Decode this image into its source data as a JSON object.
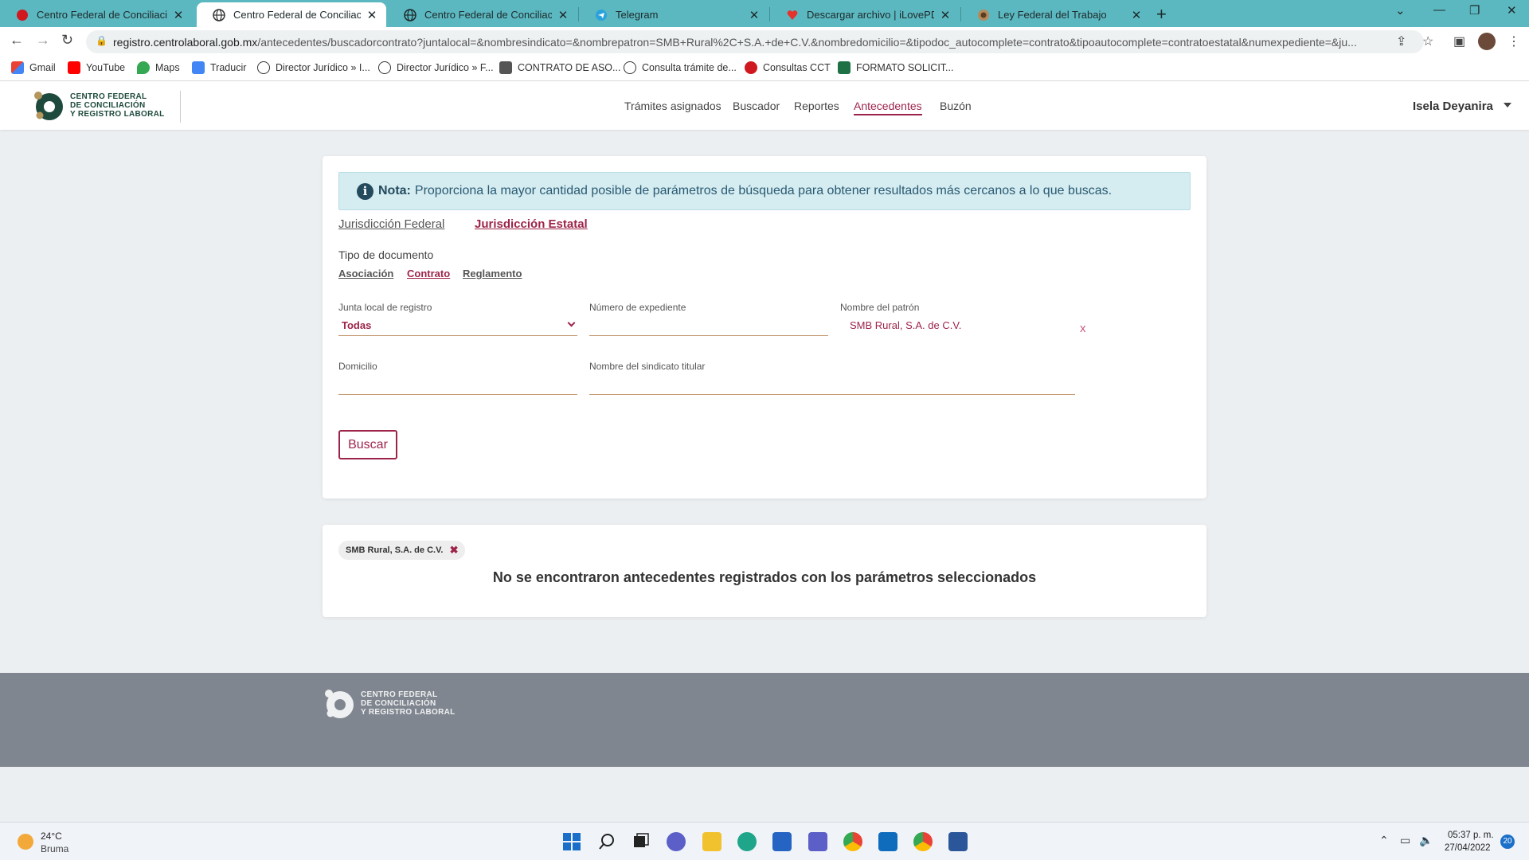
{
  "browser": {
    "tabs": [
      {
        "title": "Centro Federal de Conciliación y",
        "icon": "red-circle-icon",
        "active": false
      },
      {
        "title": "Centro Federal de Conciliación y",
        "icon": "globe-icon",
        "active": true
      },
      {
        "title": "Centro Federal de Conciliación y",
        "icon": "globe-icon",
        "active": false
      },
      {
        "title": "Telegram",
        "icon": "telegram-icon",
        "active": false
      },
      {
        "title": "Descargar archivo | iLovePDF",
        "icon": "heart-icon",
        "active": false
      },
      {
        "title": "Ley Federal del Trabajo",
        "icon": "mexico-seal-icon",
        "active": false
      }
    ],
    "url_host": "registro.centrolaboral.gob.mx",
    "url_rest": "/antecedentes/buscadorcontrato?juntalocal=&nombresindicato=&nombrepatron=SMB+Rural%2C+S.A.+de+C.V.&nombredomicilio=&tipodoc_autocomplete=contrato&tipoautocomplete=contratoestatal&numexpediente=&ju...",
    "bookmarks": [
      {
        "label": "Gmail",
        "icon": "gmail-icon"
      },
      {
        "label": "YouTube",
        "icon": "youtube-icon"
      },
      {
        "label": "Maps",
        "icon": "maps-icon"
      },
      {
        "label": "Traducir",
        "icon": "translate-icon"
      },
      {
        "label": "Director Jurídico » I...",
        "icon": "wordpress-icon"
      },
      {
        "label": "Director Jurídico » F...",
        "icon": "wordpress-icon"
      },
      {
        "label": "CONTRATO DE ASO...",
        "icon": "document-icon"
      },
      {
        "label": "Consulta trámite de...",
        "icon": "globe-icon"
      },
      {
        "label": "Consultas CCT",
        "icon": "red-circle-icon"
      },
      {
        "label": "FORMATO SOLICIT...",
        "icon": "excel-icon"
      }
    ]
  },
  "site": {
    "logo_lines": [
      "CENTRO FEDERAL",
      "DE CONCILIACIÓN",
      "Y REGISTRO LABORAL"
    ],
    "nav": [
      "Trámites asignados",
      "Buscador",
      "Reportes",
      "Antecedentes",
      "Buzón"
    ],
    "active_nav": "Antecedentes",
    "user": "Isela Deyanira"
  },
  "search": {
    "note_label": "Nota:",
    "note_text": "Proporciona la mayor cantidad posible de parámetros de búsqueda para obtener resultados más cercanos a lo que buscas.",
    "jurisdiccion_federal": "Jurisdicción Federal",
    "jurisdiccion_estatal": "Jurisdicción Estatal",
    "tipo_documento_label": "Tipo de documento",
    "doc_types": [
      "Asociación",
      "Contrato",
      "Reglamento"
    ],
    "selected_doc_type": "Contrato",
    "fields": {
      "junta_label": "Junta local de registro",
      "junta_value": "Todas",
      "expediente_label": "Número de expediente",
      "expediente_value": "",
      "patron_label": "Nombre del patrón",
      "patron_value": "SMB Rural, S.A. de C.V.",
      "clear_label": "x",
      "domicilio_label": "Domicilio",
      "domicilio_value": "",
      "sindicato_label": "Nombre del sindicato titular",
      "sindicato_value": ""
    },
    "submit_label": "Buscar"
  },
  "results": {
    "filter_chip": "SMB Rural, S.A. de C.V.",
    "empty_message": "No se encontraron antecedentes registrados con los parámetros seleccionados"
  },
  "taskbar": {
    "temperature": "24°C",
    "weather": "Bruma",
    "time": "05:37 p. m.",
    "date": "27/04/2022",
    "notifications": "20"
  },
  "colors": {
    "brand": "#9d2449",
    "tabbar": "#5cb8c0",
    "footer": "#80868f",
    "note_bg": "#d5ecf1"
  }
}
